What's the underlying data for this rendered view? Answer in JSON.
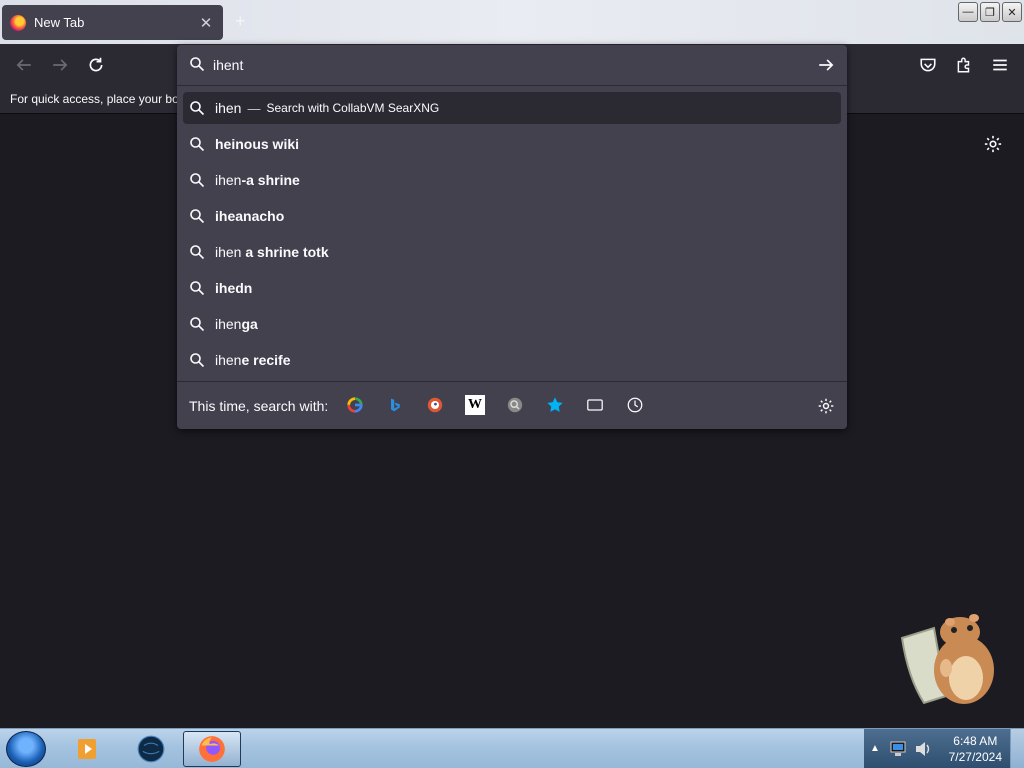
{
  "tab": {
    "title": "New Tab",
    "close": "✕"
  },
  "window_controls": {
    "minimize": "—",
    "restore": "❐",
    "close": "✕"
  },
  "urlbar": {
    "value": "ihent",
    "suggestions": [
      {
        "pre": "ihen",
        "bold": "",
        "hint": "Search with CollabVM SearXNG",
        "selected": true
      },
      {
        "pre": "",
        "bold": "heinous wiki"
      },
      {
        "pre": "ihen",
        "bold": "-a shrine"
      },
      {
        "pre": "",
        "bold": "iheanacho"
      },
      {
        "pre": "ihen ",
        "bold": "a shrine totk"
      },
      {
        "pre": "",
        "bold": "ihedn"
      },
      {
        "pre": "ihen",
        "bold": "ga"
      },
      {
        "pre": "ihen",
        "bold": "e recife"
      }
    ],
    "dash": "—",
    "search_with_label": "This time, search with:"
  },
  "engines": [
    "google",
    "bing",
    "duckduckgo",
    "wikipedia",
    "searxng",
    "bookmarks",
    "tabs",
    "history"
  ],
  "bookmarks_bar": {
    "text": "For quick access, place your bookmarks here on the bookmarks toolbar."
  },
  "taskbar": {
    "time": "6:48 AM",
    "date": "7/27/2024"
  },
  "colors": {
    "toolbar": "#2b2a33",
    "popup": "#42414d",
    "content": "#1c1b22",
    "text": "#fbfbfe"
  }
}
